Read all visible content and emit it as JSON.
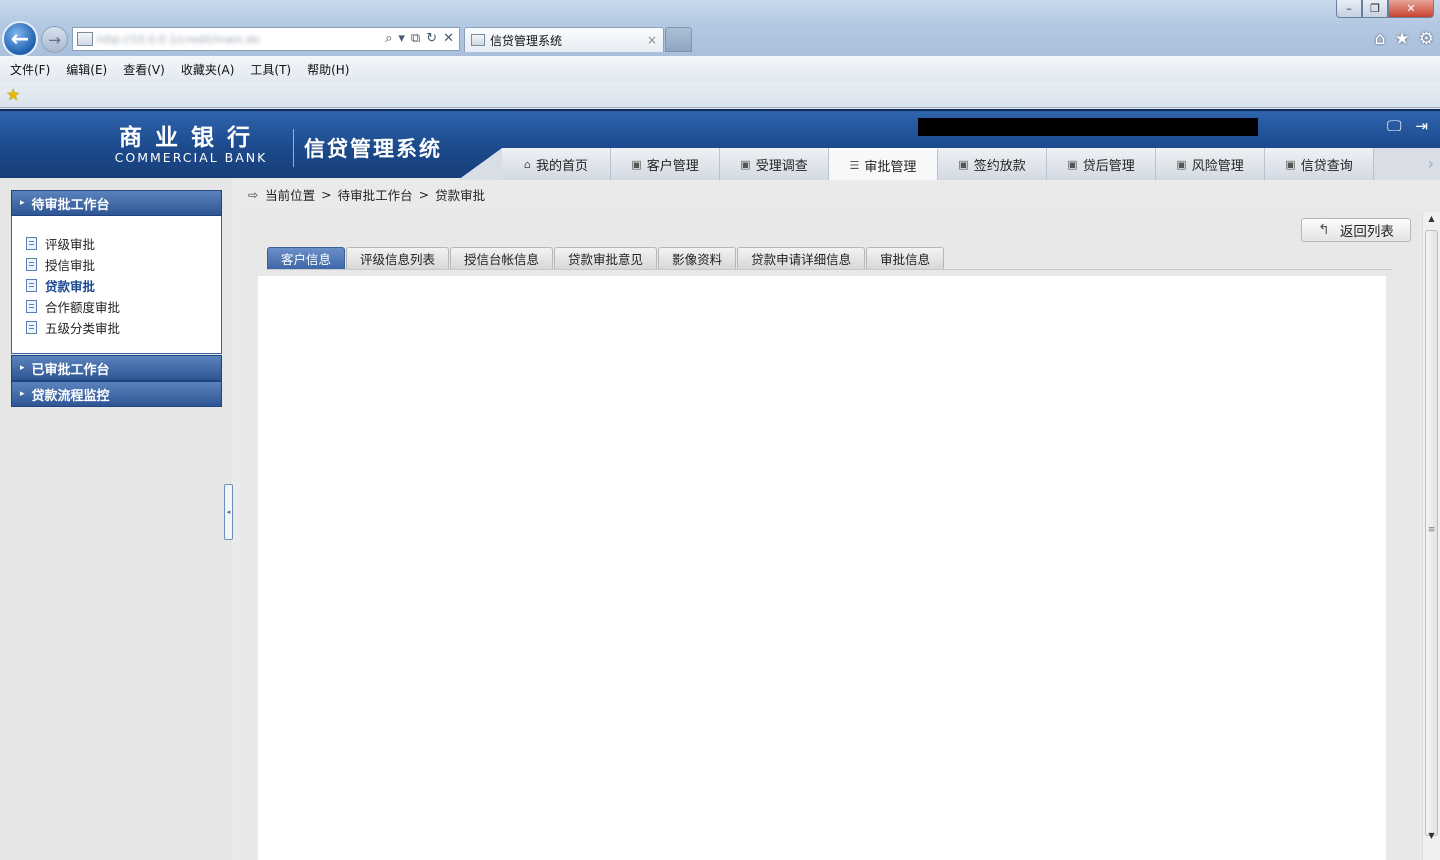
{
  "browser": {
    "tab_title": "信贷管理系统",
    "tab_close": "×",
    "back": "←",
    "forward": "→",
    "address_url": "http://10.0.0.1/credit/main.do",
    "address_tools": [
      "⌕",
      "▾",
      "⧉",
      "↻",
      "✕"
    ],
    "window_controls": {
      "min": "–",
      "max": "❐",
      "close": "✕"
    },
    "right_icons": {
      "home": "⌂",
      "favorites": "★",
      "settings": "⚙"
    }
  },
  "menubar": [
    "文件(F)",
    "编辑(E)",
    "查看(V)",
    "收藏夹(A)",
    "工具(T)",
    "帮助(H)"
  ],
  "header": {
    "logo_cn": "商业银行",
    "logo_en": "COMMERCIAL BANK",
    "system_title": "信贷管理系统",
    "icons": {
      "monitor": "🖵",
      "logout": "⇥"
    }
  },
  "nav_tabs": [
    {
      "label": "我的首页",
      "icon": "⌂"
    },
    {
      "label": "客户管理",
      "icon": "▣"
    },
    {
      "label": "受理调查",
      "icon": "▣"
    },
    {
      "label": "审批管理",
      "icon": "☰"
    },
    {
      "label": "签约放款",
      "icon": "▣"
    },
    {
      "label": "贷后管理",
      "icon": "▣"
    },
    {
      "label": "风险管理",
      "icon": "▣"
    },
    {
      "label": "信贷查询",
      "icon": "▣"
    }
  ],
  "nav_more": "›",
  "sidebar": {
    "panel1": {
      "title": "待审批工作台",
      "items": [
        "评级审批",
        "授信审批",
        "贷款审批",
        "合作额度审批",
        "五级分类审批"
      ]
    },
    "panel2": {
      "title": "已审批工作台"
    },
    "panel3": {
      "title": "贷款流程监控"
    },
    "arrow": "▸",
    "splitter": "◂"
  },
  "breadcrumb": {
    "icon": "⇨",
    "path": [
      "当前位置",
      "待审批工作台",
      "贷款审批"
    ],
    "sep": ">"
  },
  "back_button": {
    "label": "返回列表",
    "icon": "↰"
  },
  "subtabs": [
    "客户信息",
    "评级信息列表",
    "授信台帐信息",
    "贷款审批意见",
    "影像资料",
    "贷款申请详细信息",
    "审批信息"
  ],
  "scrollbar": {
    "up": "▲",
    "down": "▼",
    "grip": "≡"
  }
}
